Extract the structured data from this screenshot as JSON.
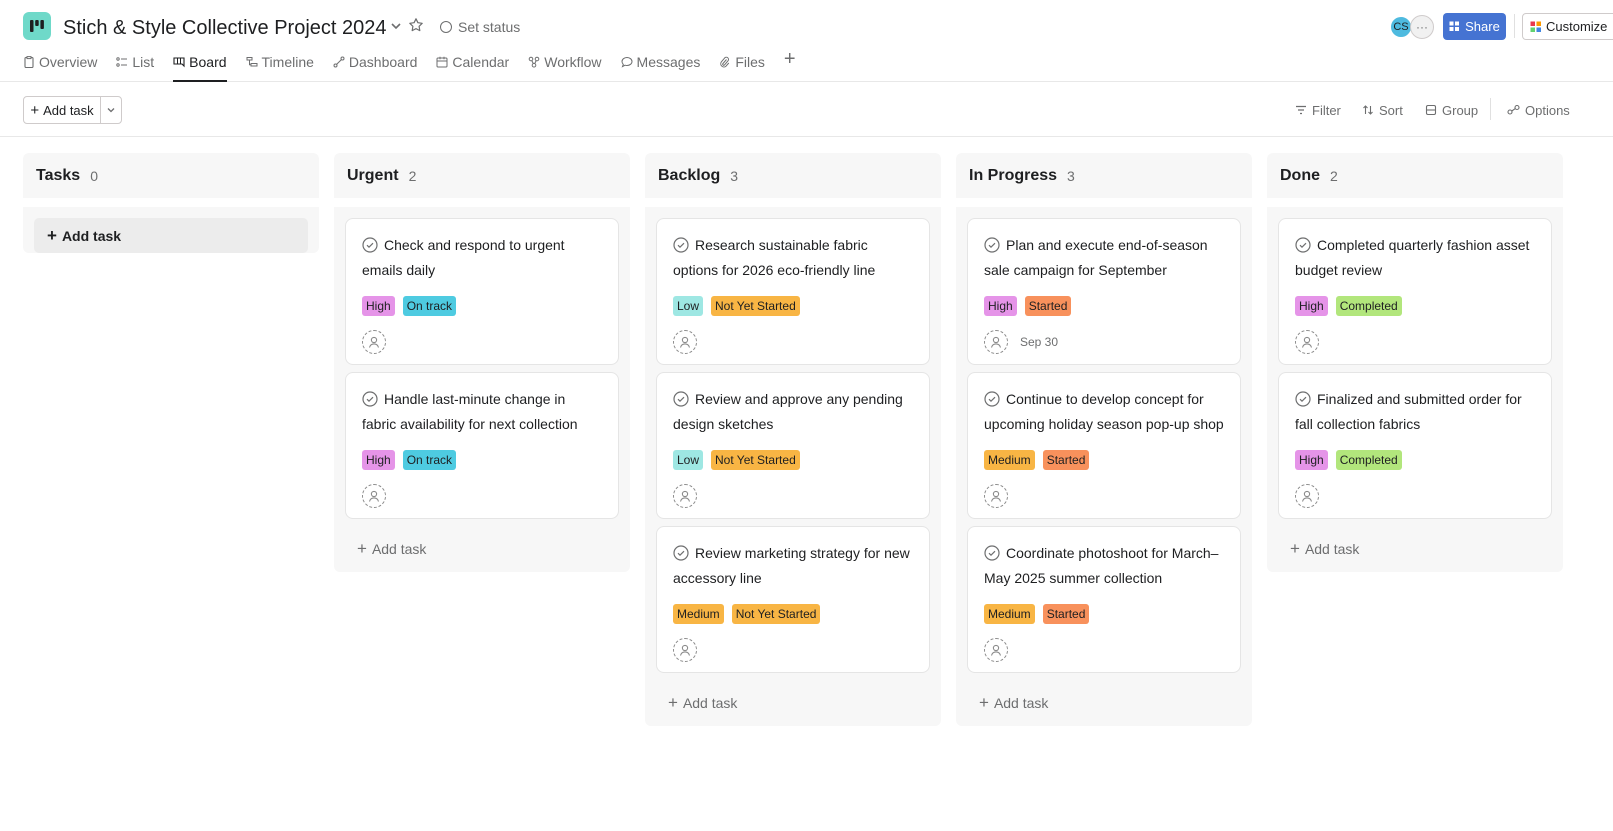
{
  "project": {
    "title": "Stich & Style Collective Project 2024",
    "set_status": "Set status",
    "icon": "board-icon",
    "icon_color": "#6fd9c9"
  },
  "header": {
    "avatar_initials": "CS",
    "avatar_color": "#4ebadf",
    "more_label": "···",
    "share_label": "Share",
    "share_color": "#4573d2",
    "customize_label": "Customize"
  },
  "tabs": [
    {
      "label": "Overview",
      "icon": "clipboard-icon"
    },
    {
      "label": "List",
      "icon": "list-icon"
    },
    {
      "label": "Board",
      "icon": "board-icon",
      "active": true
    },
    {
      "label": "Timeline",
      "icon": "timeline-icon"
    },
    {
      "label": "Dashboard",
      "icon": "dashboard-icon"
    },
    {
      "label": "Calendar",
      "icon": "calendar-icon"
    },
    {
      "label": "Workflow",
      "icon": "workflow-icon"
    },
    {
      "label": "Messages",
      "icon": "message-icon"
    },
    {
      "label": "Files",
      "icon": "paperclip-icon"
    }
  ],
  "toolbar": {
    "add_task": "Add task",
    "filter": "Filter",
    "sort": "Sort",
    "group": "Group",
    "options": "Options"
  },
  "colors": {
    "High": "#e594e8",
    "Low": "#9ee7e3",
    "Medium": "#f8b544",
    "On track": "#4ecbe1",
    "Not Yet Started": "#f8b544",
    "Started": "#f8915c",
    "Completed": "#b2e67c"
  },
  "columns": [
    {
      "name": "Tasks",
      "count": "0",
      "empty_add": "Add task",
      "cards": []
    },
    {
      "name": "Urgent",
      "count": "2",
      "add_label": "Add task",
      "cards": [
        {
          "title": "Check and respond to urgent emails daily",
          "priority": "High",
          "status": "On track",
          "due": ""
        },
        {
          "title": "Handle last-minute change in fabric availability for next collection",
          "priority": "High",
          "status": "On track",
          "due": ""
        }
      ]
    },
    {
      "name": "Backlog",
      "count": "3",
      "add_label": "Add task",
      "cards": [
        {
          "title": "Research sustainable fabric options for 2026 eco-friendly line",
          "priority": "Low",
          "status": "Not Yet Started",
          "due": ""
        },
        {
          "title": "Review and approve any pending design sketches",
          "priority": "Low",
          "status": "Not Yet Started",
          "due": ""
        },
        {
          "title": "Review marketing strategy for new accessory line",
          "priority": "Medium",
          "status": "Not Yet Started",
          "due": ""
        }
      ]
    },
    {
      "name": "In Progress",
      "count": "3",
      "add_label": "Add task",
      "cards": [
        {
          "title": "Plan and execute end-of-season sale campaign for September",
          "priority": "High",
          "status": "Started",
          "due": "Sep 30"
        },
        {
          "title": "Continue to develop concept for upcoming holiday season pop-up shop",
          "priority": "Medium",
          "status": "Started",
          "due": ""
        },
        {
          "title": "Coordinate photoshoot for March–May 2025 summer collection",
          "priority": "Medium",
          "status": "Started",
          "due": ""
        }
      ]
    },
    {
      "name": "Done",
      "count": "2",
      "add_label": "Add task",
      "cards": [
        {
          "title": "Completed quarterly fashion asset budget review",
          "priority": "High",
          "status": "Completed",
          "due": ""
        },
        {
          "title": "Finalized and submitted order for fall collection fabrics",
          "priority": "High",
          "status": "Completed",
          "due": ""
        }
      ]
    }
  ]
}
